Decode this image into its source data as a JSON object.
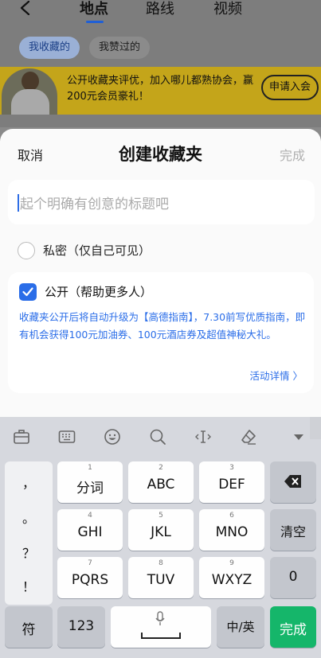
{
  "nav": {
    "tabs": [
      "地点",
      "路线",
      "视频"
    ],
    "active_tab": "地点"
  },
  "filters": [
    "我收藏的",
    "我赞过的"
  ],
  "banner": {
    "text": "公开收藏夹评优，加入哪儿都熟协会，赢200元会员豪礼！",
    "button": "申请入会"
  },
  "sheet": {
    "cancel": "取消",
    "title": "创建收藏夹",
    "done": "完成",
    "input_placeholder": "起个明确有创意的标题吧",
    "private_label": "私密（仅自己可见）",
    "public_label": "公开（帮助更多人）",
    "public_desc": "收藏夹公开后将自动升级为【高德指南】，7.30前写优质指南，即有机会获得100元加油券、100元酒店券及超值神秘大礼。",
    "activity_link": "活动详情 〉"
  },
  "keyboard": {
    "toolbar_icons": [
      "briefcase-icon",
      "keyboard-icon",
      "emoji-icon",
      "search-icon",
      "cursor-icon",
      "clear-format-icon",
      "collapse-icon"
    ],
    "symbols": [
      "，",
      "。",
      "？",
      "！"
    ],
    "rows": [
      [
        {
          "num": "1",
          "label": "分词"
        },
        {
          "num": "2",
          "label": "ABC"
        },
        {
          "num": "3",
          "label": "DEF"
        }
      ],
      [
        {
          "num": "4",
          "label": "GHI"
        },
        {
          "num": "5",
          "label": "JKL"
        },
        {
          "num": "6",
          "label": "MNO"
        }
      ],
      [
        {
          "num": "7",
          "label": "PQRS"
        },
        {
          "num": "8",
          "label": "TUV"
        },
        {
          "num": "9",
          "label": "WXYZ"
        }
      ]
    ],
    "right_keys": [
      "清空",
      "0"
    ],
    "bottom": {
      "symbol_key": "符",
      "num_key": "123",
      "lang_key": "中/英",
      "done_key": "完成"
    },
    "accent_color": "#15b66a"
  }
}
